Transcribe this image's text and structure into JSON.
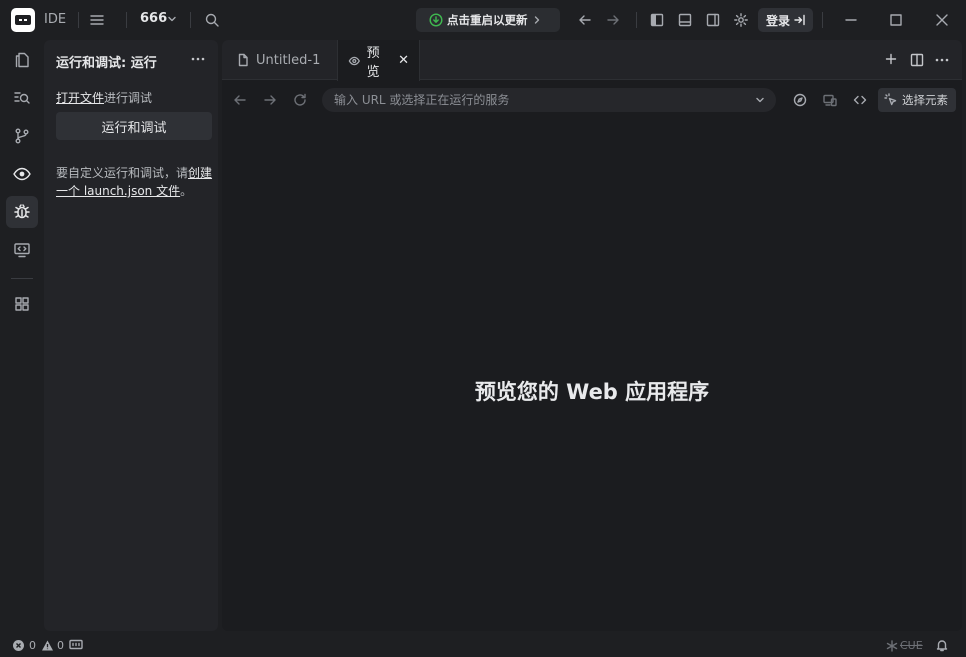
{
  "titlebar": {
    "app_name": "IDE",
    "project_name": "666",
    "update_label": "点击重启以更新",
    "login_label": "登录"
  },
  "activity": {
    "items": [
      "explorer-icon",
      "search-icon",
      "source-control-icon",
      "preview-icon",
      "debug-icon",
      "remote-icon",
      "extensions-icon"
    ],
    "active": "debug-icon"
  },
  "sidepanel": {
    "title": "运行和调试: 运行",
    "open_file_link": "打开文件",
    "open_file_suffix": "进行调试",
    "run_button": "运行和调试",
    "custom_prefix": "要自定义运行和调试，请",
    "custom_link": "创建一个 launch.json 文件",
    "custom_suffix": "。"
  },
  "editor": {
    "tabs": [
      {
        "label": "Untitled-1",
        "icon": "file-icon",
        "active": false
      },
      {
        "label": "预览",
        "icon": "eye-icon",
        "active": true
      }
    ],
    "url_placeholder": "输入 URL 或选择正在运行的服务",
    "select_element_label": "选择元素",
    "preview_heading": "预览您的 Web 应用程序"
  },
  "statusbar": {
    "errors": "0",
    "warnings": "0",
    "right_text": "CUE"
  },
  "colors": {
    "background": "#1e1f22",
    "panel": "#232428",
    "update_accent": "#3fb950"
  }
}
